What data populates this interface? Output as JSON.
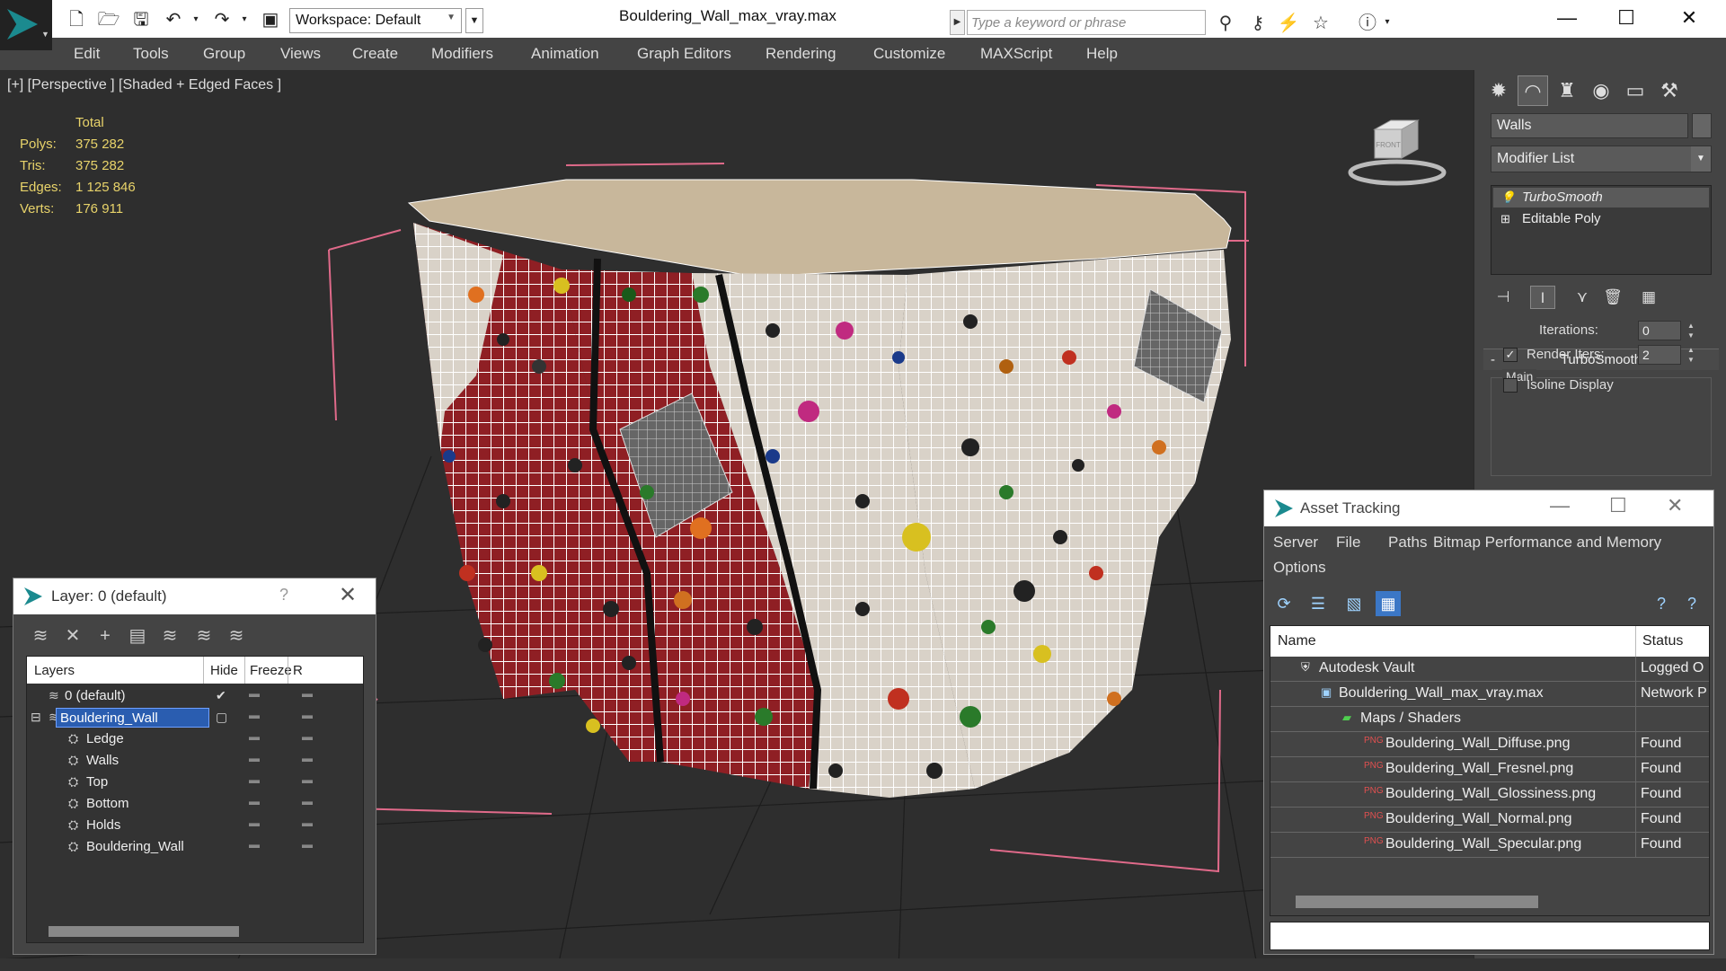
{
  "titlebar": {
    "workspace_label": "Workspace: Default",
    "document_title": "Bouldering_Wall_max_vray.max",
    "search_placeholder": "Type a keyword or phrase"
  },
  "menubar": {
    "items": [
      "Edit",
      "Tools",
      "Group",
      "Views",
      "Create",
      "Modifiers",
      "Animation",
      "Graph Editors",
      "Rendering",
      "Customize",
      "MAXScript",
      "Help"
    ]
  },
  "viewport": {
    "label": "[+] [Perspective ] [Shaded + Edged Faces ]",
    "stats": {
      "header": "Total",
      "rows": [
        {
          "key": "Polys:",
          "value": "375 282"
        },
        {
          "key": "Tris:",
          "value": "375 282"
        },
        {
          "key": "Edges:",
          "value": "1 125 846"
        },
        {
          "key": "Verts:",
          "value": "176 911"
        }
      ]
    },
    "viewcube_label": "FRONT"
  },
  "command_panel": {
    "object_name": "Walls",
    "modifier_list": "Modifier List",
    "stack": [
      "TurboSmooth",
      "Editable Poly"
    ],
    "rollout_title": "TurboSmooth",
    "group_label": "Main",
    "iterations_label": "Iterations:",
    "iterations_value": "0",
    "render_iters_label": "Render Iters:",
    "render_iters_value": "2",
    "render_iters_checked": true,
    "isoline_label": "Isoline Display",
    "isoline_checked": false
  },
  "layer_window": {
    "title": "Layer: 0 (default)",
    "help": "?",
    "columns": [
      "Layers",
      "Hide",
      "Freeze",
      "R"
    ],
    "rows": [
      {
        "name": "0 (default)",
        "level": 0,
        "type": "layer"
      },
      {
        "name": "Bouldering_Wall",
        "level": 0,
        "type": "layer",
        "selected": true
      },
      {
        "name": "Ledge",
        "level": 1,
        "type": "object"
      },
      {
        "name": "Walls",
        "level": 1,
        "type": "object"
      },
      {
        "name": "Top",
        "level": 1,
        "type": "object"
      },
      {
        "name": "Bottom",
        "level": 1,
        "type": "object"
      },
      {
        "name": "Holds",
        "level": 1,
        "type": "object"
      },
      {
        "name": "Bouldering_Wall",
        "level": 1,
        "type": "object"
      }
    ]
  },
  "asset_window": {
    "title": "Asset Tracking",
    "menu": [
      "Server",
      "File",
      "Paths",
      "Bitmap Performance and Memory",
      "Options"
    ],
    "columns": [
      "Name",
      "Status"
    ],
    "rows": [
      {
        "name": "Autodesk Vault",
        "status": "Logged O",
        "indent": 1,
        "icon": "vault"
      },
      {
        "name": "Bouldering_Wall_max_vray.max",
        "status": "Network P",
        "indent": 2,
        "icon": "max"
      },
      {
        "name": "Maps / Shaders",
        "status": "",
        "indent": 3,
        "icon": "maps"
      },
      {
        "name": "Bouldering_Wall_Diffuse.png",
        "status": "Found",
        "indent": 4,
        "icon": "png"
      },
      {
        "name": "Bouldering_Wall_Fresnel.png",
        "status": "Found",
        "indent": 4,
        "icon": "png"
      },
      {
        "name": "Bouldering_Wall_Glossiness.png",
        "status": "Found",
        "indent": 4,
        "icon": "png"
      },
      {
        "name": "Bouldering_Wall_Normal.png",
        "status": "Found",
        "indent": 4,
        "icon": "png"
      },
      {
        "name": "Bouldering_Wall_Specular.png",
        "status": "Found",
        "indent": 4,
        "icon": "png"
      }
    ]
  }
}
